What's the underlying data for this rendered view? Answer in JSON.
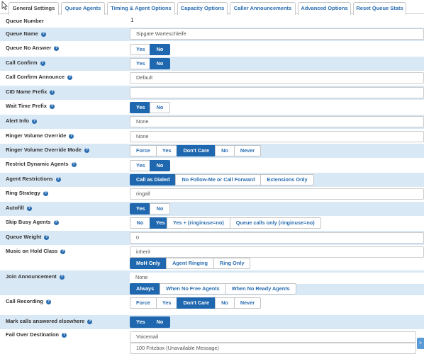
{
  "tabs": [
    "General Settings",
    "Queue Agents",
    "Timing & Agent Options",
    "Capacity Options",
    "Caller Announcements",
    "Advanced Options",
    "Reset Queue Stats"
  ],
  "help_glyph": "?",
  "rows": {
    "queue_number": {
      "label": "Queue Number",
      "value": "1"
    },
    "queue_name": {
      "label": "Queue Name",
      "value": "Sipgate Warteschleife"
    },
    "queue_no_answer": {
      "label": "Queue No Answer",
      "options": [
        "Yes",
        "No"
      ]
    },
    "call_confirm": {
      "label": "Call Confirm",
      "options": [
        "Yes",
        "No"
      ]
    },
    "call_confirm_announce": {
      "label": "Call Confirm Announce",
      "value": "Default"
    },
    "cid_name_prefix": {
      "label": "CID Name Prefix",
      "value": ""
    },
    "wait_time_prefix": {
      "label": "Wait Time Prefix",
      "options": [
        "Yes",
        "No"
      ]
    },
    "alert_info": {
      "label": "Alert Info",
      "value": "None"
    },
    "ringer_volume_override": {
      "label": "Ringer Volume Override",
      "value": "None"
    },
    "ringer_volume_override_mode": {
      "label": "Ringer Volume Override Mode",
      "options": [
        "Force",
        "Yes",
        "Don't Care",
        "No",
        "Never"
      ]
    },
    "restrict_dynamic_agents": {
      "label": "Restrict Dynamic Agents",
      "options": [
        "Yes",
        "No"
      ]
    },
    "agent_restrictions": {
      "label": "Agent Restrictions",
      "options": [
        "Call as Dialed",
        "No Follow-Me or Call Forward",
        "Extensions Only"
      ]
    },
    "ring_strategy": {
      "label": "Ring Strategy",
      "value": "ringall"
    },
    "autofill": {
      "label": "Autofill",
      "options": [
        "Yes",
        "No"
      ]
    },
    "skip_busy_agents": {
      "label": "Skip Busy Agents",
      "options": [
        "No",
        "Yes",
        "Yes + (ringinuse=no)",
        "Queue calls only (ringinuse=no)"
      ]
    },
    "queue_weight": {
      "label": "Queue Weight",
      "value": "0"
    },
    "music_on_hold": {
      "label": "Music on Hold Class",
      "value": "inherit",
      "options": [
        "MoH Only",
        "Agent Ringing",
        "Ring Only"
      ]
    },
    "join_announcement": {
      "label": "Join Announcement",
      "value": "None",
      "options": [
        "Always",
        "When No Free Agents",
        "When No Ready Agents"
      ]
    },
    "call_recording": {
      "label": "Call Recording",
      "options": [
        "Force",
        "Yes",
        "Don't Care",
        "No",
        "Never"
      ]
    },
    "mark_calls": {
      "label": "Mark calls answered elsewhere",
      "options": [
        "Yes",
        "No"
      ]
    },
    "fail_over": {
      "label": "Fail Over Destination",
      "value": "Voicemail",
      "value2": "100 Fritzbox (Unavailable Message)"
    }
  },
  "scroll_glyph": "»"
}
